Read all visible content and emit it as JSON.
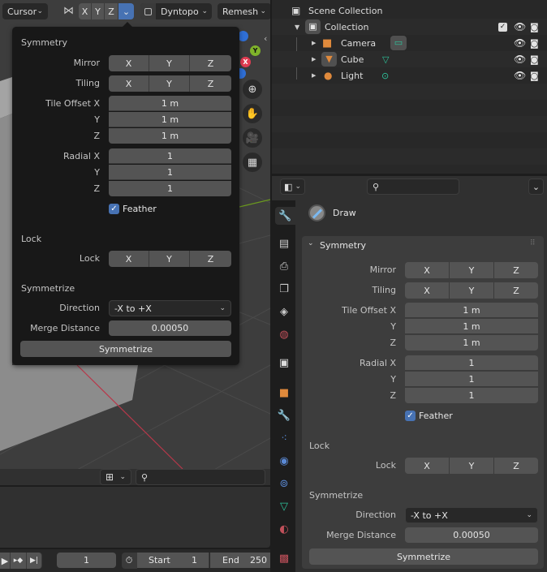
{
  "viewport_header": {
    "cursor_label": "Cursor",
    "axis_buttons": [
      "X",
      "Y",
      "Z"
    ],
    "dyntopo_label": "Dyntopo",
    "remesh_label": "Remesh",
    "accent_color": "#4772b3"
  },
  "gizmo": {
    "axes": [
      "Y",
      "X"
    ]
  },
  "symmetry": {
    "title": "Symmetry",
    "mirror_label": "Mirror",
    "mirror": [
      "X",
      "Y",
      "Z"
    ],
    "tiling_label": "Tiling",
    "tiling": [
      "X",
      "Y",
      "Z"
    ],
    "tile_offset_labels": [
      "Tile Offset X",
      "Y",
      "Z"
    ],
    "tile_offset_values": [
      "1 m",
      "1 m",
      "1 m"
    ],
    "radial_labels": [
      "Radial X",
      "Y",
      "Z"
    ],
    "radial_values": [
      "1",
      "1",
      "1"
    ],
    "feather_label": "Feather",
    "feather_checked": true,
    "lock_heading": "Lock",
    "lock_label": "Lock",
    "lock": [
      "X",
      "Y",
      "Z"
    ],
    "symmetrize_heading": "Symmetrize",
    "direction_label": "Direction",
    "direction_value": "-X to +X",
    "merge_label": "Merge Distance",
    "merge_value": "0.00050",
    "symmetrize_button": "Symmetrize"
  },
  "outliner": {
    "scene_collection": "Scene Collection",
    "collection": "Collection",
    "objects": [
      {
        "name": "Camera",
        "icon": "camera-icon"
      },
      {
        "name": "Cube",
        "icon": "mesh-icon"
      },
      {
        "name": "Light",
        "icon": "light-icon"
      }
    ]
  },
  "properties": {
    "tool_name": "Draw",
    "tabs": [
      "tool",
      "render",
      "output",
      "view-layer",
      "scene",
      "world",
      "collection",
      "object",
      "modifiers",
      "particles",
      "physics",
      "constraints",
      "data",
      "material",
      "texture"
    ]
  },
  "timeline": {
    "current_frame": "1",
    "start_label": "Start",
    "start_value": "1",
    "end_label": "End",
    "end_value": "250"
  }
}
